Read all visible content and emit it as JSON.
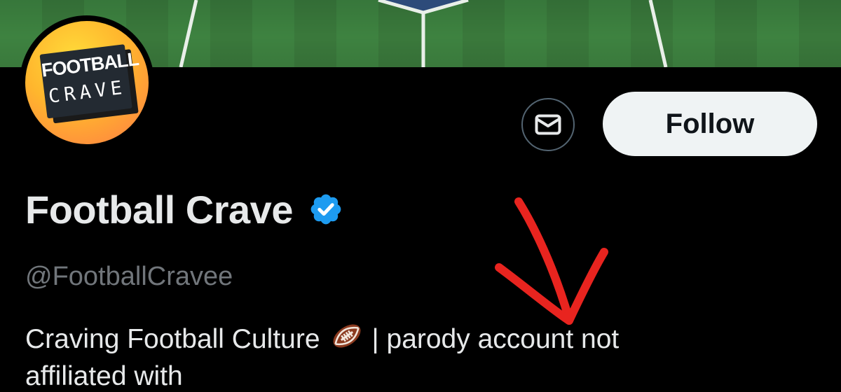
{
  "profile": {
    "display_name": "Football Crave",
    "handle": "@FootballCravee",
    "verified": true,
    "bio_part1": "Craving Football Culture",
    "bio_emoji": "american-football-icon",
    "bio_part2": "| parody account not",
    "bio_line2": "affiliated with"
  },
  "avatar": {
    "logo_line1": "FOOTBALL",
    "logo_line2": "CRAVE"
  },
  "actions": {
    "follow_label": "Follow",
    "message_icon": "envelope-icon"
  },
  "colors": {
    "background": "#000000",
    "verified_badge": "#1d9bf0",
    "follow_bg": "#eff3f4",
    "annotation": "#e8241f",
    "handle": "#71767b"
  }
}
